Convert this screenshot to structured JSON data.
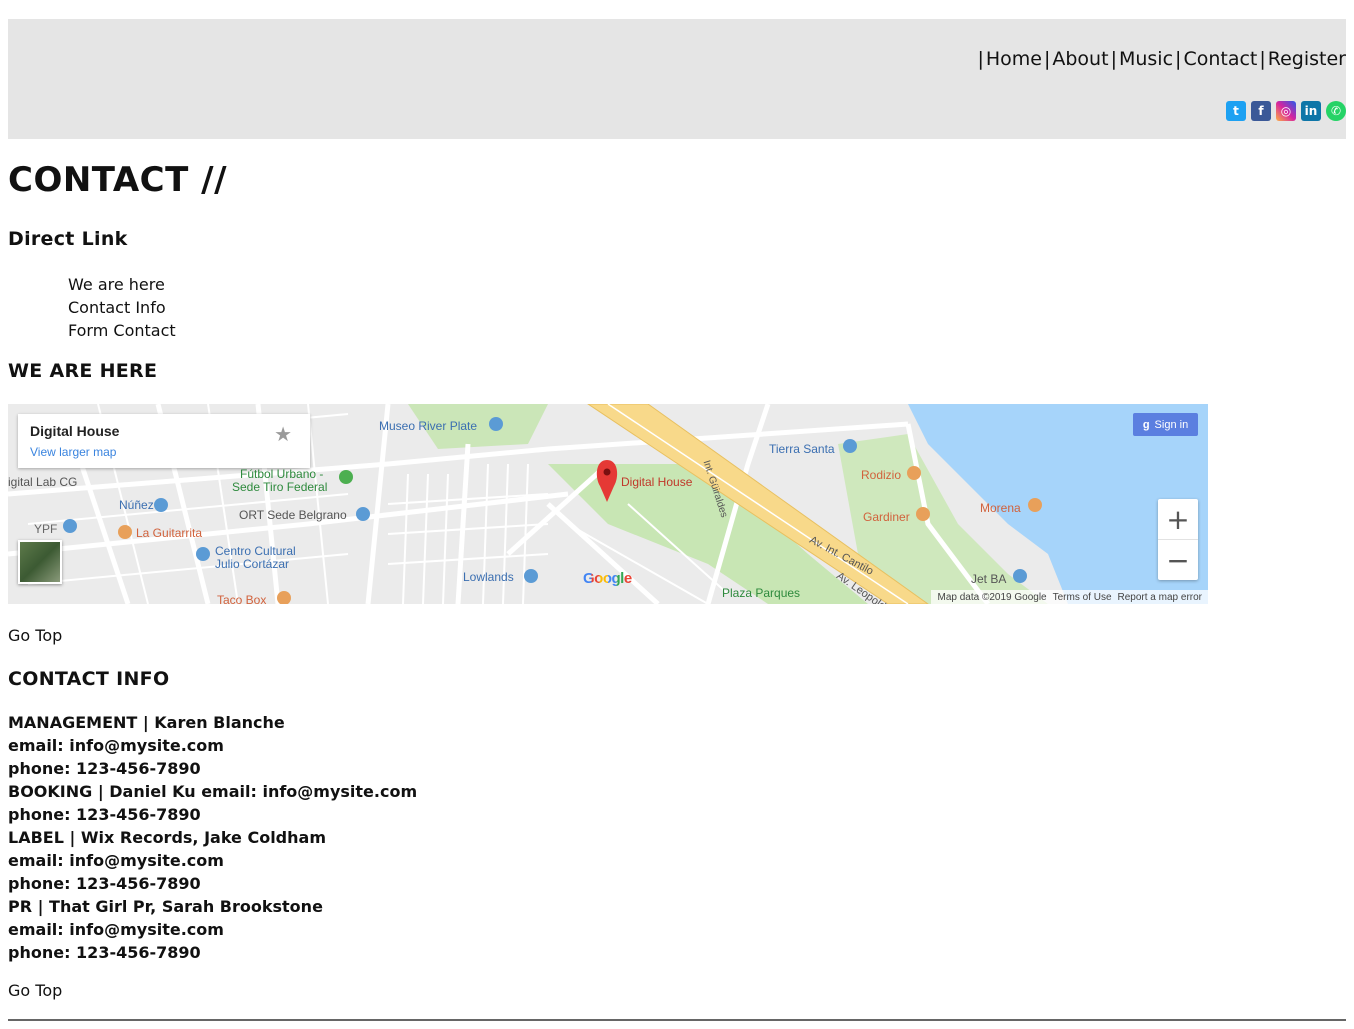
{
  "nav": {
    "items": [
      "Home",
      "About",
      "Music",
      "Contact",
      "Register"
    ],
    "separator": "|"
  },
  "social": [
    {
      "icon": "twitter-icon",
      "glyph": "t",
      "color": "#1da1f2"
    },
    {
      "icon": "facebook-icon",
      "glyph": "f",
      "color": "#3b5998"
    },
    {
      "icon": "instagram-icon",
      "glyph": "◎",
      "color": "#d6249f"
    },
    {
      "icon": "linkedin-icon",
      "glyph": "in",
      "color": "#0e76a8"
    },
    {
      "icon": "whatsapp-icon",
      "glyph": "✆",
      "color": "#25d366"
    }
  ],
  "page_title": "CONTACT //",
  "direct": {
    "heading": "Direct Link",
    "links": [
      "We are here",
      "Contact Info",
      "Form Contact"
    ]
  },
  "we_are_here": {
    "heading": "WE ARE HERE",
    "map": {
      "place": "Digital House",
      "view_larger": "View larger map",
      "sign_in": "Sign in",
      "attribution": "Map data ©2019 Google",
      "terms": "Terms of Use",
      "report": "Report a map error",
      "logo": "Google",
      "labels": {
        "museo": "Museo River Plate",
        "futbol1": "Fútbol Urbano -",
        "futbol2": "Sede Tiro Federal",
        "digital_lab": "igital Lab CG",
        "nunez": "Núñez",
        "ort": "ORT Sede Belgrano",
        "ypf": "YPF",
        "guitarrita": "La Guitarrita",
        "centro1": "Centro Cultural",
        "centro2": "Julio Cortázar",
        "lowlands": "Lowlands",
        "tacobox": "Taco Box",
        "tierra_santa": "Tierra Santa",
        "rodizio": "Rodizio",
        "gardiner": "Gardiner",
        "morena": "Morena",
        "jetba": "Jet BA",
        "plaza": "Plaza Parques",
        "digital_house": "Digital House",
        "guiraldes": "Int. Güiraldes",
        "cantilo": "Av. Int. Cantilo",
        "leopold": "Av. Leopold"
      }
    }
  },
  "go_top": "Go Top",
  "contact_info": {
    "heading": "CONTACT INFO",
    "lines": [
      "MANAGEMENT | Karen Blanche",
      "email: info@mysite.com",
      "phone: 123-456-7890",
      "BOOKING | Daniel Ku email: info@mysite.com",
      "phone: 123-456-7890",
      "LABEL | Wix Records, Jake Coldham",
      "email: info@mysite.com",
      "phone: 123-456-7890",
      "PR | That Girl Pr, Sarah Brookstone",
      "email: info@mysite.com",
      "phone: 123-456-7890"
    ]
  }
}
